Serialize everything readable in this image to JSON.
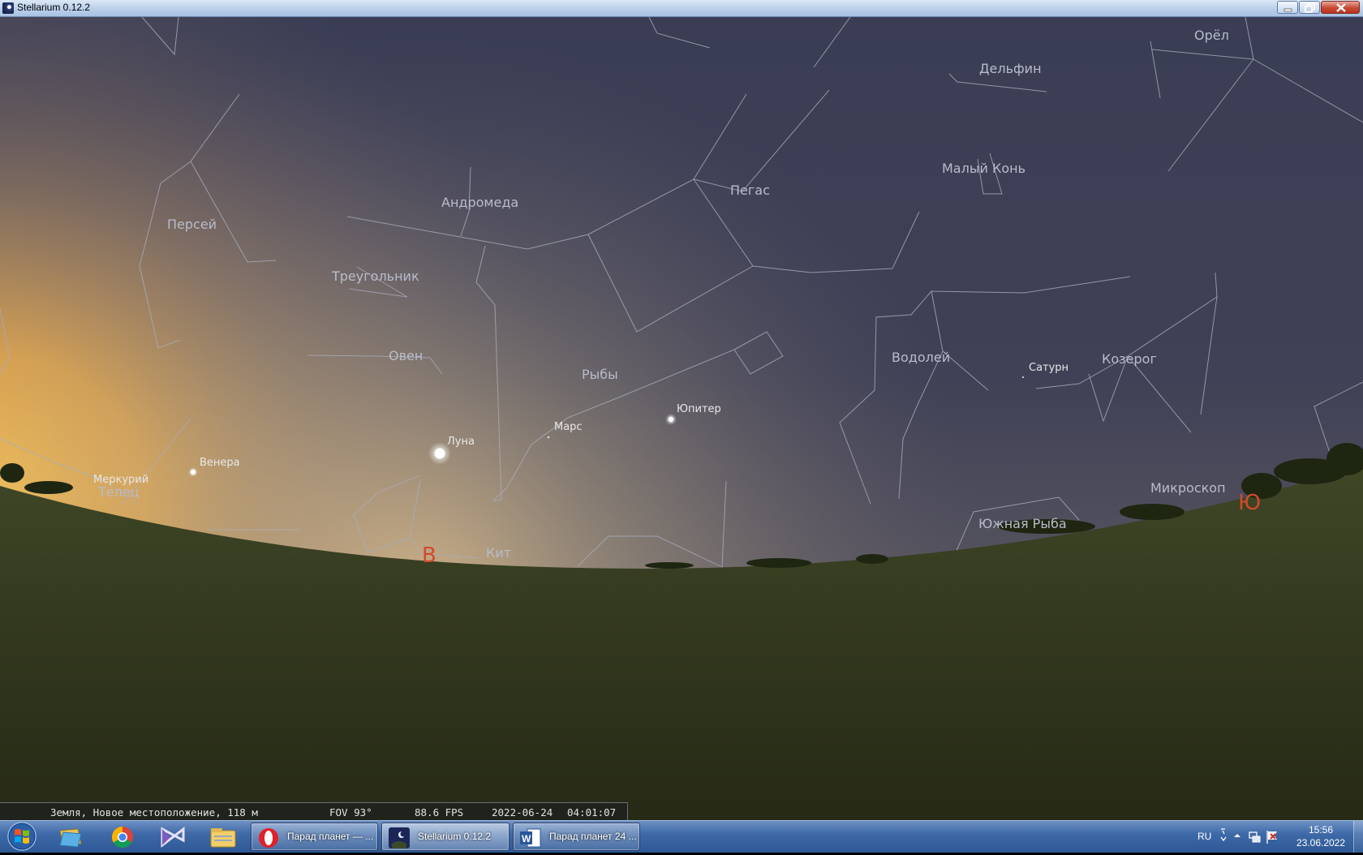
{
  "window": {
    "title": "Stellarium 0.12.2"
  },
  "sky": {
    "constellations": [
      {
        "name": "Орёл"
      },
      {
        "name": "Дельфин"
      },
      {
        "name": "Малый Конь"
      },
      {
        "name": "Пегас"
      },
      {
        "name": "Андромеда"
      },
      {
        "name": "Персей"
      },
      {
        "name": "Треугольник"
      },
      {
        "name": "Овен"
      },
      {
        "name": "Рыбы"
      },
      {
        "name": "Водолей"
      },
      {
        "name": "Козерог"
      },
      {
        "name": "Телец"
      },
      {
        "name": "Кит"
      },
      {
        "name": "Микроскоп"
      },
      {
        "name": "Южная Рыба"
      }
    ],
    "planets": [
      {
        "name": "Луна"
      },
      {
        "name": "Марс"
      },
      {
        "name": "Юпитер"
      },
      {
        "name": "Сатурн"
      },
      {
        "name": "Венера"
      },
      {
        "name": "Меркурий"
      }
    ],
    "cardinals": {
      "east": "В",
      "south": "Ю"
    }
  },
  "statusbar": {
    "location": "Земля, Новое местоположение, 118 м",
    "fov": "FOV 93°",
    "fps": "88.6 FPS",
    "date": "2022-06-24",
    "time": "04:01:07"
  },
  "taskbar": {
    "tasks": [
      {
        "label": "Парад планет — ...",
        "icon": "opera-icon"
      },
      {
        "label": "Stellarium 0.12.2",
        "icon": "stellarium-icon"
      },
      {
        "label": "Парад планет 24 ...",
        "icon": "word-icon"
      }
    ],
    "pinned": [
      "explorer-files-icon",
      "chrome-icon",
      "visual-studio-icon",
      "explorer-icon"
    ],
    "language": "RU",
    "clock_time": "15:56",
    "clock_date": "23.06.2022"
  },
  "colors": {
    "sky_top": "#3c3f57",
    "sky_horizon_glow": "#f4b24c",
    "ground": "#3a4222",
    "cardinal": "#d24a2c",
    "constellation_lines": "#a9adbd"
  }
}
